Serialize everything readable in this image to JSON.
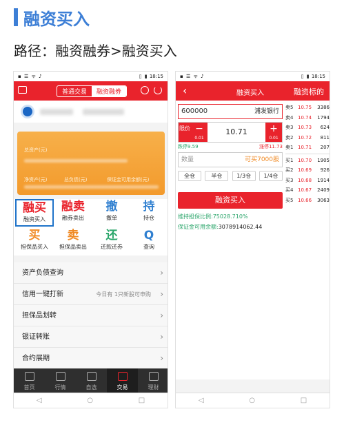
{
  "heading": "融资买入",
  "path": "路径：融资融券>融资买入",
  "status": {
    "left_icons": "▪ ☰ ᯤ ♪",
    "right_icons": "▯ ▮",
    "time": "18:15"
  },
  "left": {
    "tabs": [
      "普通交易",
      "融资融券"
    ],
    "card_labels": [
      "总资产(元)",
      "净资产(元)",
      "总负债(元)",
      "保证金可用余额(元)"
    ],
    "grid": [
      {
        "big": "融买",
        "small": "融资买入",
        "color": "#e9232c",
        "selected": true
      },
      {
        "big": "融卖",
        "small": "融券卖出",
        "color": "#e9232c"
      },
      {
        "big": "撤",
        "small": "撤单",
        "color": "#2f7fd0"
      },
      {
        "big": "持",
        "small": "持仓",
        "color": "#2f7fd0"
      },
      {
        "big": "买",
        "small": "担保品买入",
        "color": "#f08a24"
      },
      {
        "big": "卖",
        "small": "担保品卖出",
        "color": "#f08a24"
      },
      {
        "big": "还",
        "small": "还款还券",
        "color": "#2aa56a"
      },
      {
        "big": "Q",
        "small": "查询",
        "color": "#2f7fd0"
      }
    ],
    "menu": [
      {
        "label": "资产负债查询",
        "hint": ""
      },
      {
        "label": "信用一键打新",
        "hint": "今日有 1只新股可申购"
      },
      {
        "label": "担保品划转",
        "hint": ""
      },
      {
        "label": "银证转账",
        "hint": ""
      },
      {
        "label": "合约展期",
        "hint": ""
      }
    ],
    "bottom_nav": [
      "首页",
      "行情",
      "自选",
      "交易",
      "理财"
    ],
    "active_nav": 3
  },
  "right": {
    "title": "融资买入",
    "header_right": "融资标的",
    "stock_code": "600000",
    "stock_name": "浦发银行",
    "price_mode": "限价",
    "price": "10.71",
    "step_minus": "0.01",
    "step_plus": "0.01",
    "limit_up": "跌停9.59",
    "limit_down": "涨停11.73",
    "qty_placeholder": "数量",
    "qty_available": "可买7000股",
    "qty_buttons": [
      "全仓",
      "半仓",
      "1/3仓",
      "1/4仓"
    ],
    "buy_button": "融资买入",
    "ratio_text": "维持担保比例:75028.710%",
    "margin_label": "保证金可用余额:",
    "margin_value": "3078914062.44",
    "sell_levels": [
      {
        "lv": "卖5",
        "price": "10.75",
        "vol": "3386"
      },
      {
        "lv": "卖4",
        "price": "10.74",
        "vol": "1794"
      },
      {
        "lv": "卖3",
        "price": "10.73",
        "vol": "624"
      },
      {
        "lv": "卖2",
        "price": "10.72",
        "vol": "811"
      },
      {
        "lv": "卖1",
        "price": "10.71",
        "vol": "207"
      }
    ],
    "buy_levels": [
      {
        "lv": "买1",
        "price": "10.70",
        "vol": "1905"
      },
      {
        "lv": "买2",
        "price": "10.69",
        "vol": "926"
      },
      {
        "lv": "买3",
        "price": "10.68",
        "vol": "1914"
      },
      {
        "lv": "买4",
        "price": "10.67",
        "vol": "2409"
      },
      {
        "lv": "买5",
        "price": "10.66",
        "vol": "3063"
      }
    ]
  },
  "nav_icons": [
    "◁",
    "○",
    "□"
  ]
}
